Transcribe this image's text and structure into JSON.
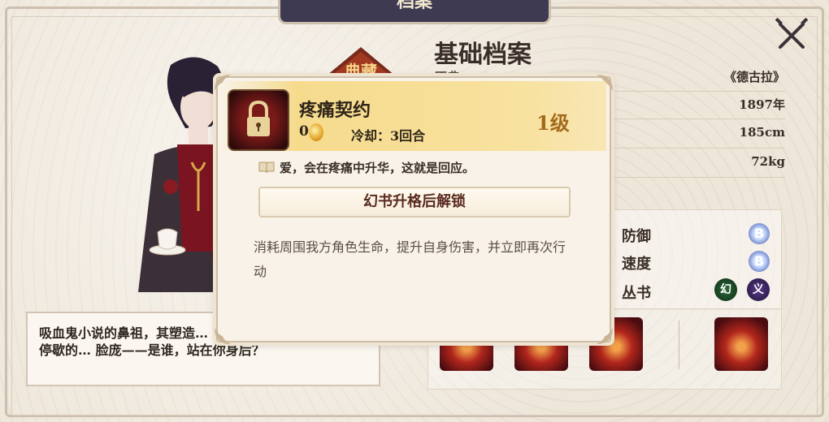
{
  "header": {
    "tab_title": "档案"
  },
  "profile": {
    "title": "基础档案",
    "rows": [
      {
        "key": "原典",
        "value": "《德古拉》"
      },
      {
        "key": "",
        "value": "1897年"
      },
      {
        "key": "",
        "value": "185cm"
      },
      {
        "key": "",
        "value": "72kg"
      }
    ],
    "collection_badge": "典藏"
  },
  "stats": {
    "rows": [
      {
        "label": "防御",
        "grade": "B"
      },
      {
        "label": "速度",
        "grade": "B"
      },
      {
        "label": "丛书",
        "tags": [
          "幻",
          "义"
        ]
      }
    ]
  },
  "description": "吸血鬼小说的鼻祖，其塑造… 不衰。雷雨夜的古堡，蝙蝠停歇的… 脸庞——是谁，站在你身后？",
  "popup": {
    "skill_name": "疼痛契约",
    "cost": "0",
    "cooldown": "冷却：3回合",
    "level": "1级",
    "quote": "爱，会在疼痛中升华，这就是回应。",
    "unlock_button": "幻书升格后解锁",
    "effect": "消耗周围我方角色生命，提升自身伤害，并立即再次行动",
    "icon": "padlock-icon"
  },
  "colors": {
    "accent_gold": "#a36a1c",
    "header_gold": "#f6db8d",
    "tab_dark": "#3e3a52"
  }
}
